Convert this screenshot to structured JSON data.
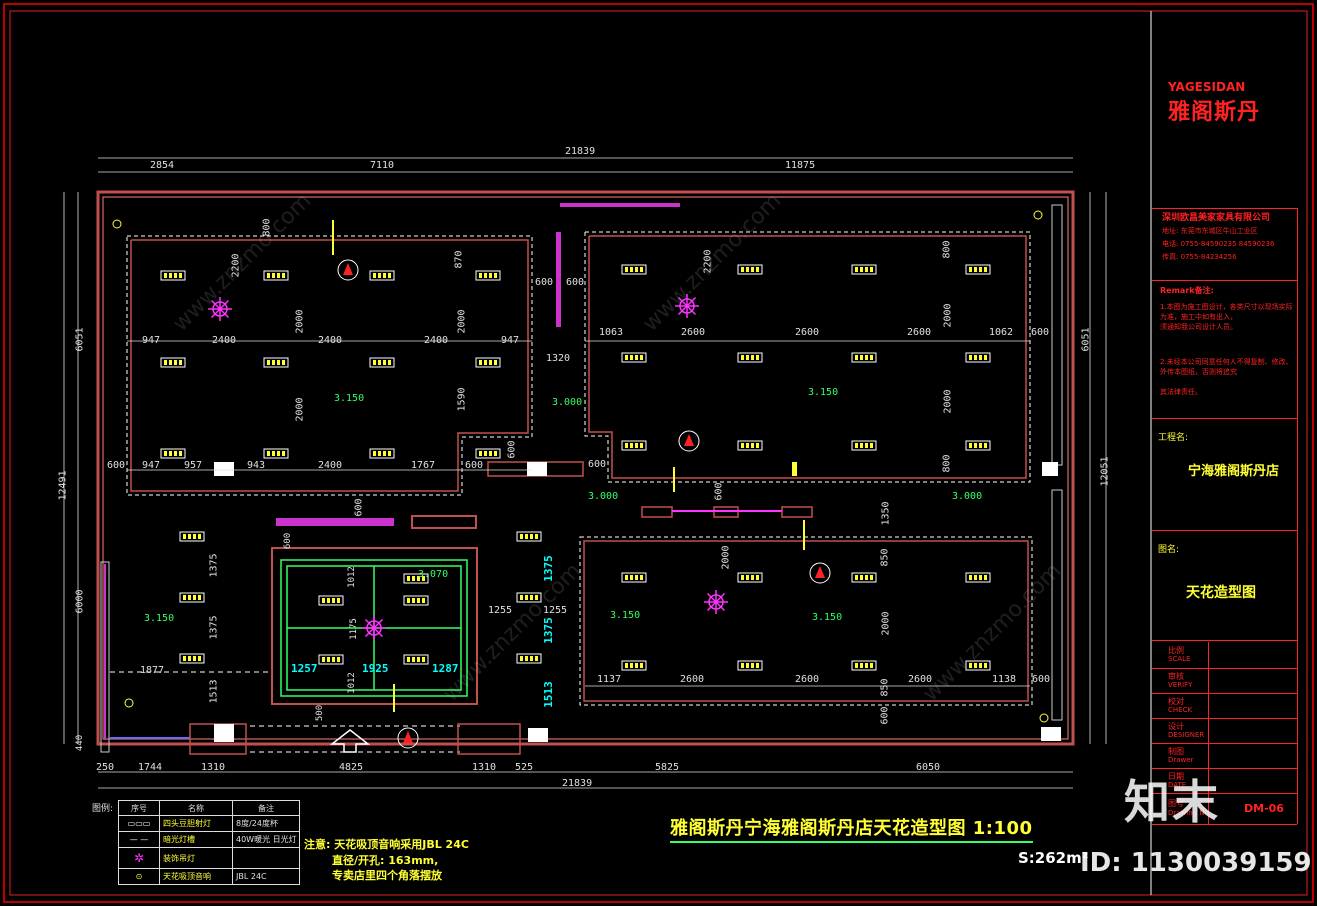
{
  "drawing": {
    "title": "雅阁斯丹宁海雅阁斯丹店天花造型图 1:100",
    "area": "S:262m²",
    "notes": [
      "注意: 天花吸顶音响采用JBL 24C",
      "直径/开孔: 163mm,",
      "专卖店里四个角落摆放"
    ],
    "legend_header": [
      "序号",
      "名称",
      "备注"
    ],
    "legend_rows": [
      {
        "symbol": "▭▭▭",
        "name": "四头豆胆射灯",
        "note": "8度/24度杯"
      },
      {
        "symbol": "— —",
        "name": "暗光灯槽",
        "note": "40W暖光 日光灯"
      },
      {
        "symbol": "✲",
        "name": "装饰吊灯",
        "note": ""
      },
      {
        "symbol": "⊙",
        "name": "天花吸顶音响",
        "note": "JBL 24C"
      }
    ],
    "legend_label": "图例:"
  },
  "dimensions": {
    "top_total": "21839",
    "top_segments": [
      "2854",
      "7110",
      "11875"
    ],
    "bottom_total": "21839",
    "bottom_segments": [
      "250",
      "1744",
      "1310",
      "4825",
      "1310",
      "525",
      "5825",
      "6050"
    ],
    "left_total": "12491",
    "left_segments": [
      "6051",
      "6000",
      "440"
    ],
    "right_total": "12051",
    "right_segments": [
      "6051"
    ],
    "room1_h": [
      "947",
      "2400",
      "2400",
      "2400",
      "947"
    ],
    "room1_bottom": [
      "600",
      "947",
      "957",
      "943",
      "2400",
      "1767",
      "600"
    ],
    "room1_v": [
      "800",
      "2200",
      "2000",
      "2000",
      "870",
      "2000",
      "1590"
    ],
    "room2_h": [
      "1063",
      "2600",
      "2600",
      "1062",
      "600"
    ],
    "room2_v": [
      "2200",
      "800",
      "2000",
      "2000",
      "800"
    ],
    "room3_h": [
      "1137",
      "2600",
      "2600",
      "2600",
      "1138",
      "600"
    ],
    "room3_v": [
      "1350",
      "850",
      "2000",
      "850",
      "600",
      "2000"
    ],
    "room4_v": [
      "1375",
      "1375",
      "1513"
    ],
    "room4_h": [
      "1877"
    ],
    "room5": [
      "1257",
      "1925",
      "1287",
      "1012",
      "1175",
      "1012",
      "600",
      "500"
    ],
    "mid_dims": [
      "600",
      "600",
      "1320",
      "600",
      "600",
      "1255",
      "1255",
      "1375",
      "1375",
      "1513",
      "600",
      "600"
    ],
    "elevations": [
      "3.150",
      "3.000",
      "3.150",
      "3.000",
      "3.000",
      "3.070",
      "3.150",
      "3.150",
      "3.150"
    ]
  },
  "title_block": {
    "brand_en": "YAGESIDAN",
    "brand_cn": "雅阁斯丹",
    "company": "深圳欧昌美家家具有限公司",
    "address": "地址: 东莞市东城区牛山工业区",
    "phone1": "电话: 0755-84590235  84590236",
    "fax": "传真: 0755-84234256",
    "remarks_title": "Remark备注:",
    "remarks": [
      "1.本图为施工图设计，各类尺寸以现场实际为准，施工中如有出入，",
      "须通知我公司设计人员。",
      "2.未经本公司同意任何人不得复制、修改、外传本图纸，否则将追究",
      "其法律责任。"
    ],
    "project_label": "工程名:",
    "project": "宁海雅阁斯丹店",
    "drawing_label": "图名:",
    "drawing_name": "天花造型图",
    "rows": [
      {
        "cn": "比例",
        "en": "SCALE"
      },
      {
        "cn": "审核",
        "en": "VERIFY"
      },
      {
        "cn": "校对",
        "en": "CHECK"
      },
      {
        "cn": "设计",
        "en": "DESIGNER"
      },
      {
        "cn": "制图",
        "en": "Drawer"
      },
      {
        "cn": "日期",
        "en": "DATE"
      },
      {
        "cn": "图号",
        "en": "Drawing No."
      }
    ],
    "drawing_no": "DM-06"
  },
  "watermark": {
    "site": "www.znzmo.com",
    "logo": "知末",
    "id": "ID: 1130039159"
  },
  "colors": {
    "wall": "#c0504d",
    "dim": "#e0e0e0",
    "text_yellow": "#ffff33",
    "text_cyan": "#00ffff",
    "magenta": "#ff33ff",
    "title_red": "#ff2222",
    "green": "#33ff66"
  }
}
